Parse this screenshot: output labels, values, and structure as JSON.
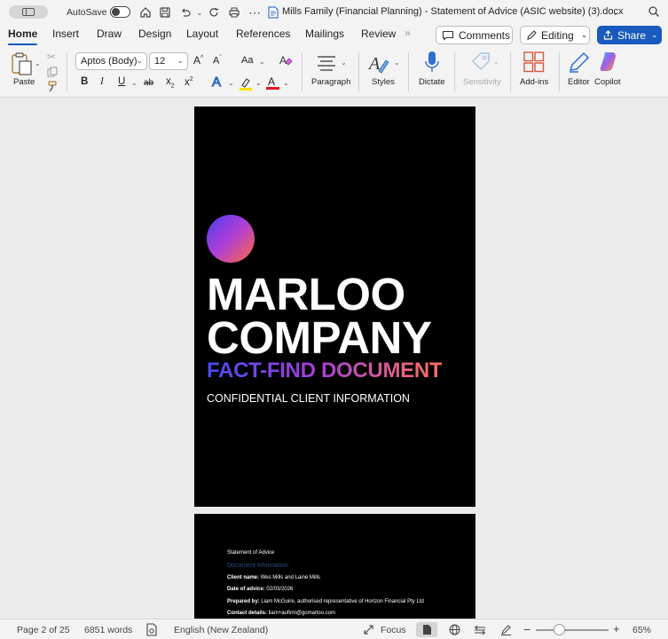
{
  "titlebar": {
    "autosave_label": "AutoSave",
    "document_title": "Mills Family (Financial Planning) - Statement of Advice (ASIC website) (3).docx"
  },
  "tabs": [
    {
      "label": "Home",
      "active": true
    },
    {
      "label": "Insert"
    },
    {
      "label": "Draw"
    },
    {
      "label": "Design"
    },
    {
      "label": "Layout"
    },
    {
      "label": "References"
    },
    {
      "label": "Mailings"
    },
    {
      "label": "Review"
    }
  ],
  "actions": {
    "comments_label": "Comments",
    "editing_label": "Editing",
    "share_label": "Share"
  },
  "ribbon": {
    "paste_label": "Paste",
    "font_name": "Aptos (Body)",
    "font_size": "12",
    "paragraph_label": "Paragraph",
    "styles_label": "Styles",
    "dictate_label": "Dictate",
    "sensitivity_label": "Sensitivity",
    "addins_label": "Add-ins",
    "editor_label": "Editor",
    "copilot_label": "Copilot",
    "grow_font": "A",
    "shrink_font": "A",
    "change_case": "Aa",
    "bold": "B",
    "italic": "I",
    "underline": "U",
    "strike": "ab",
    "subscript": "x",
    "superscript": "x",
    "text_effects": "A",
    "font_color_letter": "A",
    "highlight_color": "#f4e400",
    "font_color": "#e81123"
  },
  "page1": {
    "company_line1": "MARLOO",
    "company_line2": "COMPANY",
    "subtitle": "FACT-FIND DOCUMENT",
    "tagline": "CONFIDENTIAL CLIENT INFORMATION"
  },
  "page2": {
    "header": "Statement of Advice",
    "section_heading": "Document Information",
    "client_label": "Client name:",
    "client_value": "Wes Mills and Laine Mills",
    "date_label": "Date of advice:",
    "date_value": "02/03/2026",
    "prepared_label": "Prepared by:",
    "prepared_value": "Liam McGuire, authorised representative of Horizon Financial Pty Ltd",
    "contact_label": "Contact details:",
    "contact_value": "liam+aufirm@gomarloo.com"
  },
  "statusbar": {
    "page_info": "Page 2 of 25",
    "word_count": "6851 words",
    "language": "English (New Zealand)",
    "focus_label": "Focus",
    "zoom": "65%",
    "zoom_fraction": 0.32
  },
  "colors": {
    "accent": "#185abd"
  }
}
